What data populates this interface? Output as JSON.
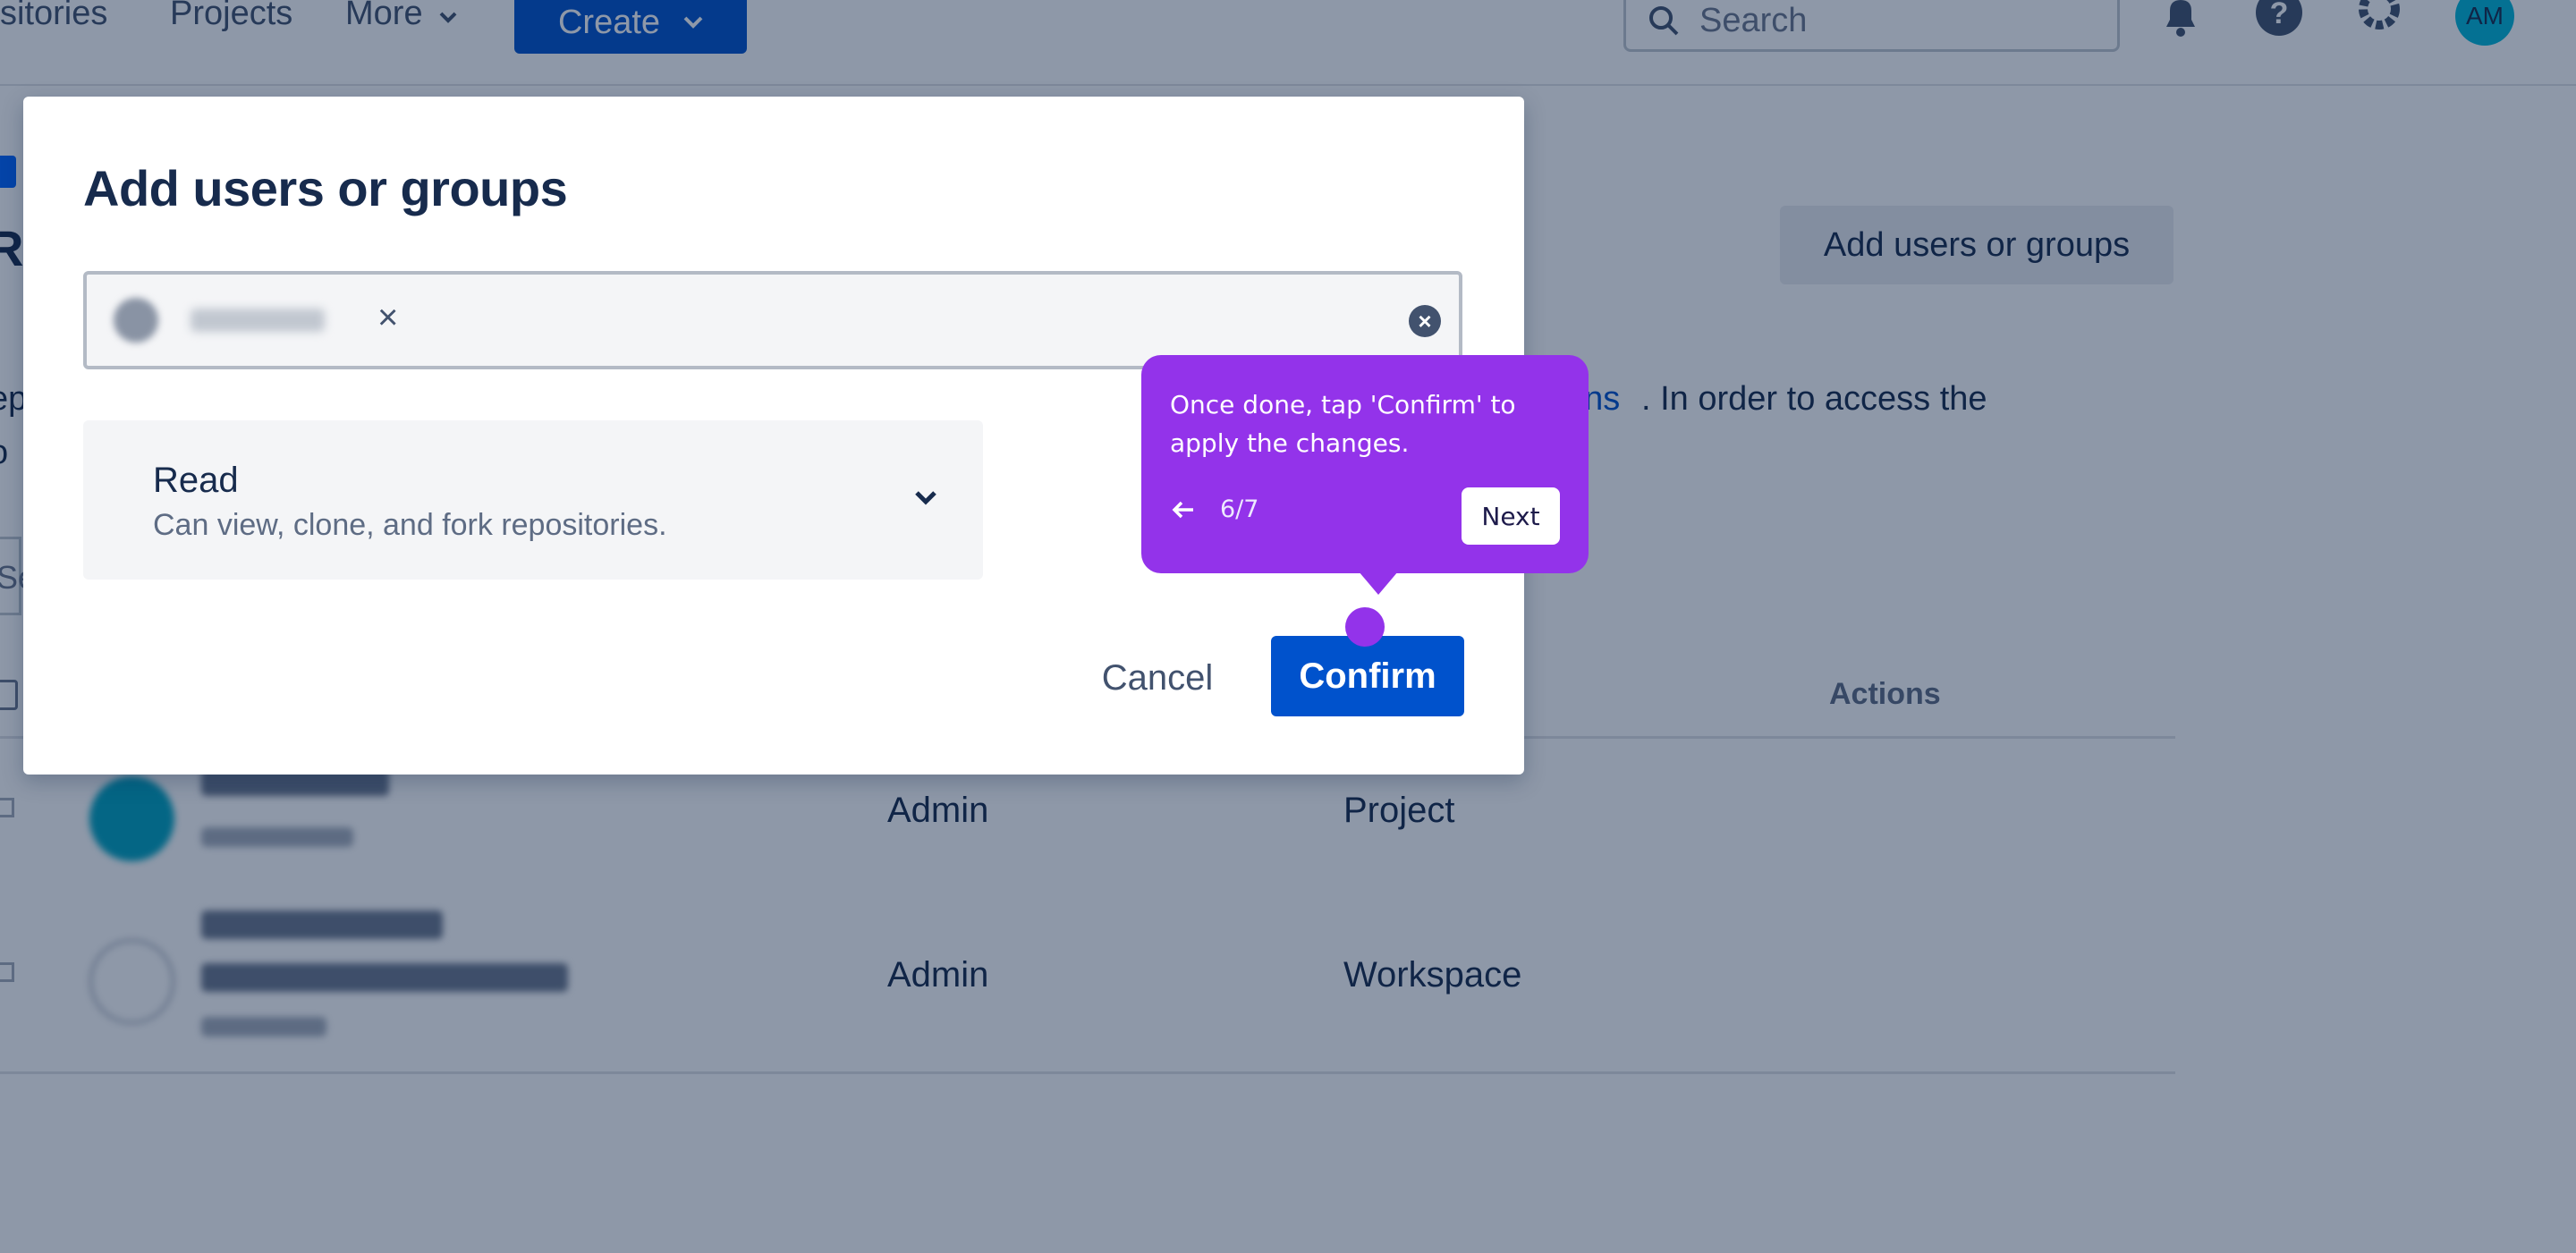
{
  "topnav": {
    "repositories_label": "sitories",
    "projects_label": "Projects",
    "more_label": "More",
    "create_label": "Create",
    "search_placeholder": "Search",
    "avatar_initials": "AM"
  },
  "page": {
    "title_fragment": "Re",
    "add_users_button": "Add users or groups",
    "desc_left_fragment_1": "ep",
    "desc_left_fragment_2": "o",
    "desc_link_fragment": "ons",
    "desc_right_fragment": ". In order to access the",
    "search_fragment": "Se",
    "table_header_actions": "Actions",
    "rows": [
      {
        "role": "Admin",
        "source": "Project"
      },
      {
        "role": "Admin",
        "source": "Workspace"
      }
    ]
  },
  "modal": {
    "title": "Add users or groups",
    "chip_remove": "×",
    "clear_icon": "×",
    "role": {
      "label": "Read",
      "description": "Can view, clone, and fork repositories."
    },
    "cancel_label": "Cancel",
    "confirm_label": "Confirm"
  },
  "tooltip": {
    "text": "Once done, tap 'Confirm' to apply the changes.",
    "step": "6/7",
    "next_label": "Next"
  },
  "colors": {
    "brand_blue": "#0052cc",
    "tooltip_purple": "#9333ea",
    "overlay": "rgba(9,30,66,0.46)"
  }
}
